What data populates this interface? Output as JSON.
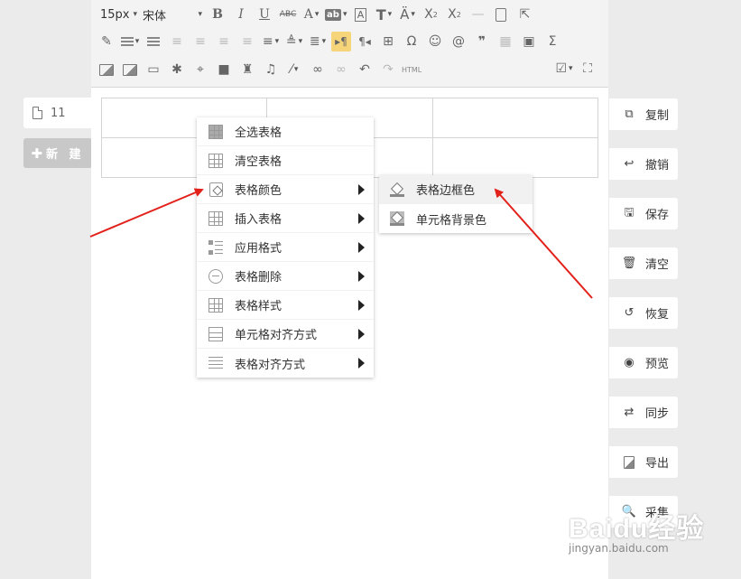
{
  "sidebar": {
    "doc_tab_label": "11",
    "new_button_label": "新 建"
  },
  "toolbar": {
    "font_size": "15px",
    "font_name": "宋体",
    "html_label": "HTML"
  },
  "context_menu": {
    "items": [
      {
        "label": "全选表格",
        "icon": "table-grid-icon",
        "has_submenu": false
      },
      {
        "label": "清空表格",
        "icon": "table-clear-icon",
        "has_submenu": false
      },
      {
        "label": "表格颜色",
        "icon": "table-color-icon",
        "has_submenu": true
      },
      {
        "label": "插入表格",
        "icon": "table-insert-icon",
        "has_submenu": true
      },
      {
        "label": "应用格式",
        "icon": "format-icon",
        "has_submenu": true
      },
      {
        "label": "表格删除",
        "icon": "minus-circle-icon",
        "has_submenu": true
      },
      {
        "label": "表格样式",
        "icon": "table-style-icon",
        "has_submenu": true
      },
      {
        "label": "单元格对齐方式",
        "icon": "cell-align-icon",
        "has_submenu": true
      },
      {
        "label": "表格对齐方式",
        "icon": "table-align-icon",
        "has_submenu": true
      }
    ]
  },
  "submenu": {
    "items": [
      {
        "label": "表格边框色",
        "icon": "paint-bucket-icon"
      },
      {
        "label": "单元格背景色",
        "icon": "paint-bucket-fill-icon"
      }
    ]
  },
  "actions": [
    {
      "label": "复制",
      "icon": "copy-icon"
    },
    {
      "label": "撤销",
      "icon": "undo-icon"
    },
    {
      "label": "保存",
      "icon": "save-icon"
    },
    {
      "label": "清空",
      "icon": "trash-icon"
    },
    {
      "label": "恢复",
      "icon": "restore-icon"
    },
    {
      "label": "预览",
      "icon": "eye-icon"
    },
    {
      "label": "同步",
      "icon": "sync-icon"
    },
    {
      "label": "导出",
      "icon": "export-image-icon"
    },
    {
      "label": "采集",
      "icon": "search-icon"
    }
  ],
  "watermark": {
    "brand": "Baidu经验",
    "url": "jingyan.baidu.com"
  },
  "colors": {
    "annotation_arrow": "#e3211b",
    "active_tool": "#f5d47a"
  }
}
